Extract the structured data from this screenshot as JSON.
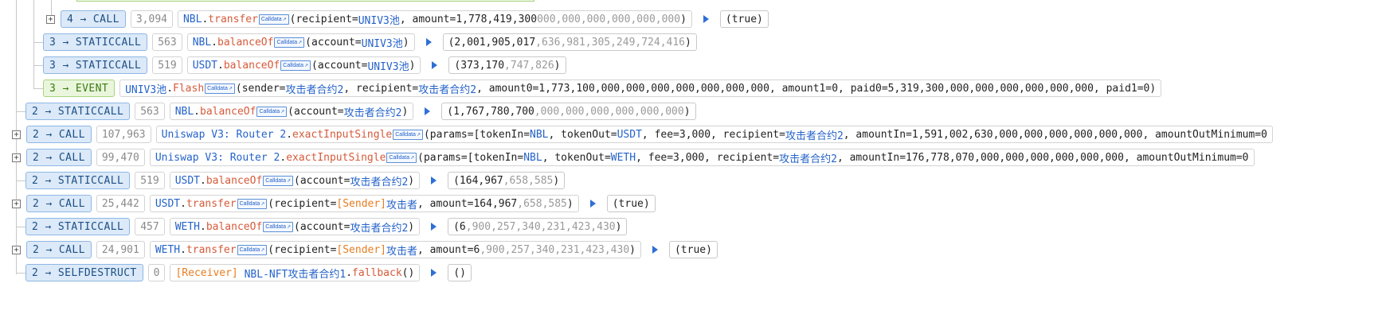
{
  "calldata_label": "Calldata",
  "rows": [
    {
      "expand": "+",
      "depth": "4",
      "kind": "CALL",
      "gas": "3,094",
      "contract": "NBL",
      "fn": "transfer",
      "args_pre": "(recipient=",
      "arg_addr": "UNIV3池",
      "args_mid": ", amount=1,778,419,300",
      "args_grey": "000,000,000,000,000,000",
      "args_end": ")",
      "ret": "(true)"
    },
    {
      "depth": "3",
      "kind": "STATICCALL",
      "gas": "563",
      "contract": "NBL",
      "fn": "balanceOf",
      "args_pre": "(account=",
      "arg_addr": "UNIV3池",
      "args_end": ")",
      "ret_main": "(2,001,905,017",
      "ret_grey": ",636,981,305,249,724,416",
      "ret_end": ")"
    },
    {
      "depth": "3",
      "kind": "STATICCALL",
      "gas": "519",
      "contract": "USDT",
      "fn": "balanceOf",
      "args_pre": "(account=",
      "arg_addr": "UNIV3池",
      "args_end": ")",
      "ret_main": "(373,170",
      "ret_grey": ",747,826",
      "ret_end": ")"
    },
    {
      "depth": "3",
      "kind": "EVENT",
      "contract": "UNIV3池",
      "fn": "Flash",
      "args_pre": "(sender=",
      "arg_addr": "攻击者合约2",
      "args_mid": ", recipient=",
      "arg_addr2": "攻击者合约2",
      "args_tail": ", amount0=1,773,100,000,000,000,000,000,000,000, amount1=0, paid0=5,319,300,000,000,000,000,000,000, paid1=0)"
    },
    {
      "depth": "2",
      "kind": "STATICCALL",
      "gas": "563",
      "contract": "NBL",
      "fn": "balanceOf",
      "args_pre": "(account=",
      "arg_addr": "攻击者合约2",
      "args_end": ")",
      "ret_main": "(1,767,780,700",
      "ret_grey": ",000,000,000,000,000,000",
      "ret_end": ")"
    },
    {
      "expand": "+",
      "depth": "2",
      "kind": "CALL",
      "gas": "107,963",
      "contract": "Uniswap V3: Router 2",
      "fn": "exactInputSingle",
      "args_pre": "(params=[tokenIn=",
      "arg_addr": "NBL",
      "args_mid": ", tokenOut=",
      "arg_addr2": "USDT",
      "args_mid2": ", fee=3,000, recipient=",
      "arg_addr3": "攻击者合约2",
      "args_tail": ", amountIn=1,591,002,630,000,000,000,000,000,000, amountOutMinimum=0"
    },
    {
      "expand": "+",
      "depth": "2",
      "kind": "CALL",
      "gas": "99,470",
      "contract": "Uniswap V3: Router 2",
      "fn": "exactInputSingle",
      "args_pre": "(params=[tokenIn=",
      "arg_addr": "NBL",
      "args_mid": ", tokenOut=",
      "arg_addr2": "WETH",
      "args_mid2": ", fee=3,000, recipient=",
      "arg_addr3": "攻击者合约2",
      "args_tail": ", amountIn=176,778,070,000,000,000,000,000,000, amountOutMinimum=0"
    },
    {
      "depth": "2",
      "kind": "STATICCALL",
      "gas": "519",
      "contract": "USDT",
      "fn": "balanceOf",
      "args_pre": "(account=",
      "arg_addr": "攻击者合约2",
      "args_end": ")",
      "ret_main": "(164,967",
      "ret_grey": ",658,585",
      "ret_end": ")"
    },
    {
      "expand": "+",
      "depth": "2",
      "kind": "CALL",
      "gas": "25,442",
      "contract": "USDT",
      "fn": "transfer",
      "args_pre": "(recipient=",
      "sender": "[Sender]",
      "arg_addr": "攻击者",
      "args_mid": ", amount=164,967",
      "args_grey": ",658,585",
      "args_end": ")",
      "ret": "(true)"
    },
    {
      "depth": "2",
      "kind": "STATICCALL",
      "gas": "457",
      "contract": "WETH",
      "fn": "balanceOf",
      "args_pre": "(account=",
      "arg_addr": "攻击者合约2",
      "args_end": ")",
      "ret_main": "(6",
      "ret_grey": ",900,257,340,231,423,430",
      "ret_end": ")"
    },
    {
      "expand": "+",
      "depth": "2",
      "kind": "CALL",
      "gas": "24,901",
      "contract": "WETH",
      "fn": "transfer",
      "args_pre": "(recipient=",
      "sender": "[Sender]",
      "arg_addr": "攻击者",
      "args_mid": ", amount=6",
      "args_grey": ",900,257,340,231,423,430",
      "args_end": ")",
      "ret": "(true)"
    },
    {
      "depth": "2",
      "kind": "SELFDESTRUCT",
      "gas": "0",
      "receiver": "[Receiver]",
      "contract": "NBL-NFT攻击者合约1",
      "fn": "fallback",
      "args_end": "()",
      "ret": "()"
    }
  ]
}
